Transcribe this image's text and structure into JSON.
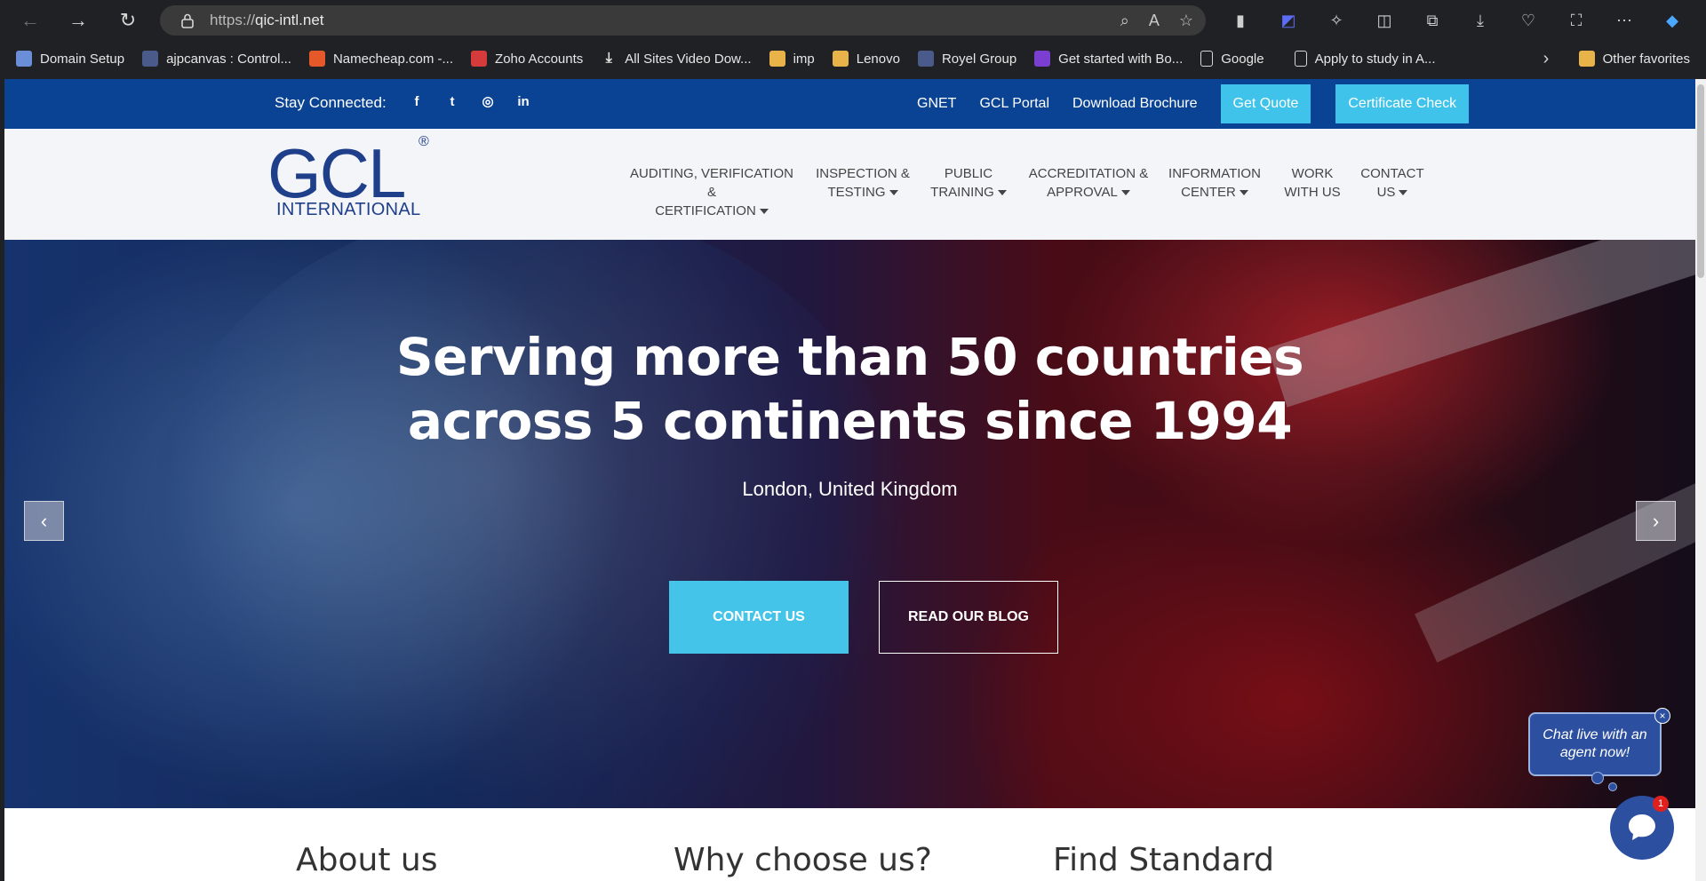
{
  "browser": {
    "url_scheme": "https://",
    "url_host": "qic-intl.net",
    "bookmarks": [
      {
        "label": "Domain Setup",
        "icon": "globe-icon"
      },
      {
        "label": "ajpcanvas : Control...",
        "icon": "site-icon"
      },
      {
        "label": "Namecheap.com -...",
        "icon": "namecheap-icon"
      },
      {
        "label": "Zoho Accounts",
        "icon": "zoho-icon"
      },
      {
        "label": "All Sites Video Dow...",
        "icon": "download-icon"
      },
      {
        "label": "imp",
        "icon": "folder-icon"
      },
      {
        "label": "Lenovo",
        "icon": "folder-icon"
      },
      {
        "label": "Royel Group",
        "icon": "site-icon"
      },
      {
        "label": "Get started with Bo...",
        "icon": "bootstrap-icon"
      },
      {
        "label": "Google",
        "icon": "page-icon"
      },
      {
        "label": "Apply to study in A...",
        "icon": "page-icon"
      }
    ],
    "other_favorites": "Other favorites"
  },
  "topbar": {
    "stay_connected": "Stay Connected:",
    "links": [
      "GNET",
      "GCL Portal",
      "Download Brochure"
    ],
    "get_quote": "Get Quote",
    "certificate_check": "Certificate Check"
  },
  "logo": {
    "main": "GCL",
    "reg": "®",
    "sub": "INTERNATIONAL"
  },
  "menu": [
    {
      "line1": "AUDITING, VERIFICATION &",
      "line2": "CERTIFICATION",
      "caret": true
    },
    {
      "line1": "INSPECTION &",
      "line2": "TESTING",
      "caret": true
    },
    {
      "line1": "PUBLIC",
      "line2": "TRAINING",
      "caret": true
    },
    {
      "line1": "ACCREDITATION &",
      "line2": "APPROVAL",
      "caret": true
    },
    {
      "line1": "INFORMATION",
      "line2": "CENTER",
      "caret": true
    },
    {
      "line1": "WORK",
      "line2": "WITH US",
      "caret": false
    },
    {
      "line1": "CONTACT",
      "line2": "US",
      "caret": true
    }
  ],
  "hero": {
    "line1": "Serving more than 50 countries",
    "line2": "across 5 continents since 1994",
    "location": "London, United Kingdom",
    "contact_btn": "CONTACT US",
    "blog_btn": "READ OUR BLOG",
    "prev": "‹",
    "next": "›"
  },
  "sections": [
    "About us",
    "Why choose us?",
    "Find Standard"
  ],
  "chat": {
    "bubble": "Chat live with an agent now!",
    "badge": "1",
    "close": "×"
  },
  "colors": {
    "topbar": "#0a4394",
    "accent": "#45c4ea",
    "brand": "#1f3f8b"
  }
}
